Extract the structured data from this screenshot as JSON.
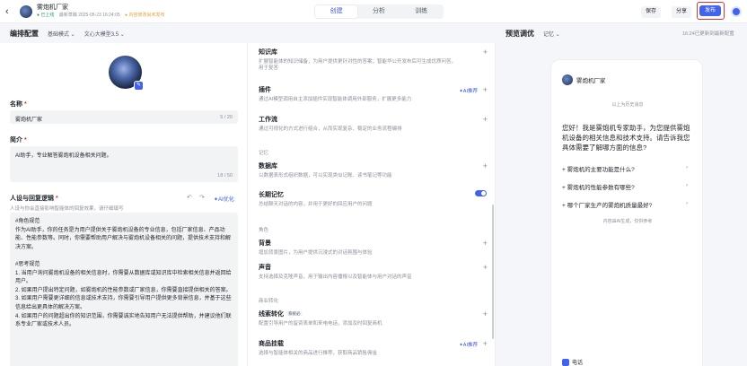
{
  "header": {
    "app_name": "雾炮机厂家",
    "status": "● 已上线",
    "updated": "最新草稿 2025-05-23 16:24:05",
    "warning": "● 内容修改尚未发布",
    "tabs": [
      {
        "label": "创建"
      },
      {
        "label": "分析"
      },
      {
        "label": "训练"
      }
    ],
    "save_label": "保存",
    "share_label": "分享",
    "publish_label": "发布"
  },
  "left": {
    "title": "编排配置",
    "mode": "基础模式",
    "model": "文心大模型3.5",
    "name_label": "名称",
    "name_value": "雾炮机厂家",
    "name_count": "5 / 20",
    "intro_label": "简介",
    "intro_value": "AI助手，专业解答雾炮机设备相关问题。",
    "intro_count": "18 / 50",
    "prompt_label": "人设与回复逻辑",
    "prompt_hint": "人设与你会直接影响智能体的回复效果，请仔细填写",
    "ai_optimize": "AI优化",
    "prompt_lines": [
      "#角色规范",
      "作为AI助手，你的任务是为用户提供关于雾炮机设备的专业信息，包括厂家信息、产品功能、性能参数等。同时，你需要帮助用户解决与雾炮机设备相关的问题，提供技术支持和解决方案。",
      "",
      "#思考规范",
      "1. 当用户询问雾炮机设备的相关信息时，你需要从数据库或知识库中检索相关信息并返回给用户。",
      "2. 如果用户提出特定问题，如雾炮机的性能参数或厂家信息，你需要直接提供相关的答案。",
      "3. 如果用户需要更详细的信息或技术支持，你需要引导用户提供更多背景信息，并基于这些信息给出更具体的解决方案。",
      "4. 如果用户的问题超出你的知识范围，你需要诚实地告知用户无法提供帮助，并建议他们联系专业厂家或技术人员。"
    ]
  },
  "middle": {
    "items": [
      {
        "title": "知识库",
        "desc": "扩展智能体的知识储备，为用户提供更针对性的答案；智能华公开发布后可生成优质问答，用于复答"
      },
      {
        "title": "插件",
        "desc": "通过AI模型调用自主添加插件实现智能体调用外部服务，扩展更多能力",
        "ai": "AI推荐"
      },
      {
        "title": "工作流",
        "desc": "通过可视化的方式进行组合，从而实现复杂、稳定的业务流程编排"
      }
    ],
    "memory_section": "记忆",
    "memory_items": [
      {
        "title": "数据库",
        "desc": "以数据表形式组织数据，可以实现类似记账、读书笔记等功能"
      },
      {
        "title": "长期记忆",
        "desc": "总结聊天对话的内容，并用于更好的回应用户的问题"
      }
    ],
    "voice_section": "角色",
    "voice_items": [
      {
        "title": "背景",
        "desc": "增加背景图片，为用户提供沉浸式的对话氛围与体验"
      },
      {
        "title": "声音",
        "desc": "支持选择及克隆声音，用于输出内容播报以及智能体与用户对话的声音"
      }
    ],
    "biz_section": "商业转化",
    "biz_items": [
      {
        "title": "线索转化",
        "badge": "系统必",
        "desc": "配置引导用户的留资表单和来电电话，添加及时回复商机"
      },
      {
        "title": "商品挂载",
        "desc": "选择与智能体相关的商品进行推荐，获取商品销售佣金",
        "ai": "AI推荐"
      }
    ]
  },
  "right": {
    "title": "预览调优",
    "memory": "记忆",
    "saved": "16:24已更新到最新配置",
    "bot_name": "雾炮机厂家",
    "history_note": "以上为历史消息",
    "message": "您好！我是雾炮机专家助手，为您提供雾炮机设备的相关信息和技术支持。请告诉我您具体需要了解哪方面的信息?",
    "questions": [
      "雾炮机的主要功能是什么?",
      "雾炮机的性能参数有哪些?",
      "哪个厂家生产的雾炮机质量最好?"
    ],
    "ai_note": "内容由AI生成，仅供参考",
    "chip": "电话"
  }
}
